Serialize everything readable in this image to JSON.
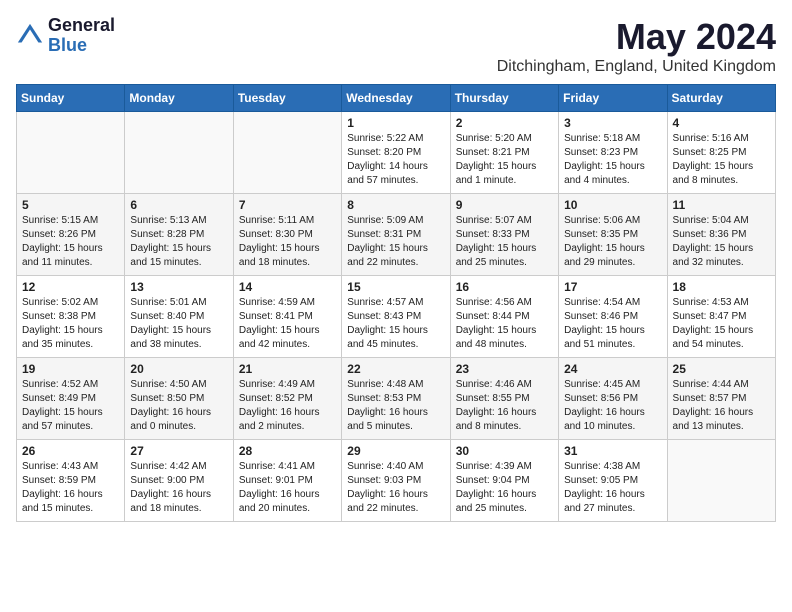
{
  "logo": {
    "general": "General",
    "blue": "Blue"
  },
  "title": "May 2024",
  "location": "Ditchingham, England, United Kingdom",
  "days_of_week": [
    "Sunday",
    "Monday",
    "Tuesday",
    "Wednesday",
    "Thursday",
    "Friday",
    "Saturday"
  ],
  "weeks": [
    [
      {
        "day": "",
        "info": ""
      },
      {
        "day": "",
        "info": ""
      },
      {
        "day": "",
        "info": ""
      },
      {
        "day": "1",
        "info": "Sunrise: 5:22 AM\nSunset: 8:20 PM\nDaylight: 14 hours\nand 57 minutes."
      },
      {
        "day": "2",
        "info": "Sunrise: 5:20 AM\nSunset: 8:21 PM\nDaylight: 15 hours\nand 1 minute."
      },
      {
        "day": "3",
        "info": "Sunrise: 5:18 AM\nSunset: 8:23 PM\nDaylight: 15 hours\nand 4 minutes."
      },
      {
        "day": "4",
        "info": "Sunrise: 5:16 AM\nSunset: 8:25 PM\nDaylight: 15 hours\nand 8 minutes."
      }
    ],
    [
      {
        "day": "5",
        "info": "Sunrise: 5:15 AM\nSunset: 8:26 PM\nDaylight: 15 hours\nand 11 minutes."
      },
      {
        "day": "6",
        "info": "Sunrise: 5:13 AM\nSunset: 8:28 PM\nDaylight: 15 hours\nand 15 minutes."
      },
      {
        "day": "7",
        "info": "Sunrise: 5:11 AM\nSunset: 8:30 PM\nDaylight: 15 hours\nand 18 minutes."
      },
      {
        "day": "8",
        "info": "Sunrise: 5:09 AM\nSunset: 8:31 PM\nDaylight: 15 hours\nand 22 minutes."
      },
      {
        "day": "9",
        "info": "Sunrise: 5:07 AM\nSunset: 8:33 PM\nDaylight: 15 hours\nand 25 minutes."
      },
      {
        "day": "10",
        "info": "Sunrise: 5:06 AM\nSunset: 8:35 PM\nDaylight: 15 hours\nand 29 minutes."
      },
      {
        "day": "11",
        "info": "Sunrise: 5:04 AM\nSunset: 8:36 PM\nDaylight: 15 hours\nand 32 minutes."
      }
    ],
    [
      {
        "day": "12",
        "info": "Sunrise: 5:02 AM\nSunset: 8:38 PM\nDaylight: 15 hours\nand 35 minutes."
      },
      {
        "day": "13",
        "info": "Sunrise: 5:01 AM\nSunset: 8:40 PM\nDaylight: 15 hours\nand 38 minutes."
      },
      {
        "day": "14",
        "info": "Sunrise: 4:59 AM\nSunset: 8:41 PM\nDaylight: 15 hours\nand 42 minutes."
      },
      {
        "day": "15",
        "info": "Sunrise: 4:57 AM\nSunset: 8:43 PM\nDaylight: 15 hours\nand 45 minutes."
      },
      {
        "day": "16",
        "info": "Sunrise: 4:56 AM\nSunset: 8:44 PM\nDaylight: 15 hours\nand 48 minutes."
      },
      {
        "day": "17",
        "info": "Sunrise: 4:54 AM\nSunset: 8:46 PM\nDaylight: 15 hours\nand 51 minutes."
      },
      {
        "day": "18",
        "info": "Sunrise: 4:53 AM\nSunset: 8:47 PM\nDaylight: 15 hours\nand 54 minutes."
      }
    ],
    [
      {
        "day": "19",
        "info": "Sunrise: 4:52 AM\nSunset: 8:49 PM\nDaylight: 15 hours\nand 57 minutes."
      },
      {
        "day": "20",
        "info": "Sunrise: 4:50 AM\nSunset: 8:50 PM\nDaylight: 16 hours\nand 0 minutes."
      },
      {
        "day": "21",
        "info": "Sunrise: 4:49 AM\nSunset: 8:52 PM\nDaylight: 16 hours\nand 2 minutes."
      },
      {
        "day": "22",
        "info": "Sunrise: 4:48 AM\nSunset: 8:53 PM\nDaylight: 16 hours\nand 5 minutes."
      },
      {
        "day": "23",
        "info": "Sunrise: 4:46 AM\nSunset: 8:55 PM\nDaylight: 16 hours\nand 8 minutes."
      },
      {
        "day": "24",
        "info": "Sunrise: 4:45 AM\nSunset: 8:56 PM\nDaylight: 16 hours\nand 10 minutes."
      },
      {
        "day": "25",
        "info": "Sunrise: 4:44 AM\nSunset: 8:57 PM\nDaylight: 16 hours\nand 13 minutes."
      }
    ],
    [
      {
        "day": "26",
        "info": "Sunrise: 4:43 AM\nSunset: 8:59 PM\nDaylight: 16 hours\nand 15 minutes."
      },
      {
        "day": "27",
        "info": "Sunrise: 4:42 AM\nSunset: 9:00 PM\nDaylight: 16 hours\nand 18 minutes."
      },
      {
        "day": "28",
        "info": "Sunrise: 4:41 AM\nSunset: 9:01 PM\nDaylight: 16 hours\nand 20 minutes."
      },
      {
        "day": "29",
        "info": "Sunrise: 4:40 AM\nSunset: 9:03 PM\nDaylight: 16 hours\nand 22 minutes."
      },
      {
        "day": "30",
        "info": "Sunrise: 4:39 AM\nSunset: 9:04 PM\nDaylight: 16 hours\nand 25 minutes."
      },
      {
        "day": "31",
        "info": "Sunrise: 4:38 AM\nSunset: 9:05 PM\nDaylight: 16 hours\nand 27 minutes."
      },
      {
        "day": "",
        "info": ""
      }
    ]
  ]
}
